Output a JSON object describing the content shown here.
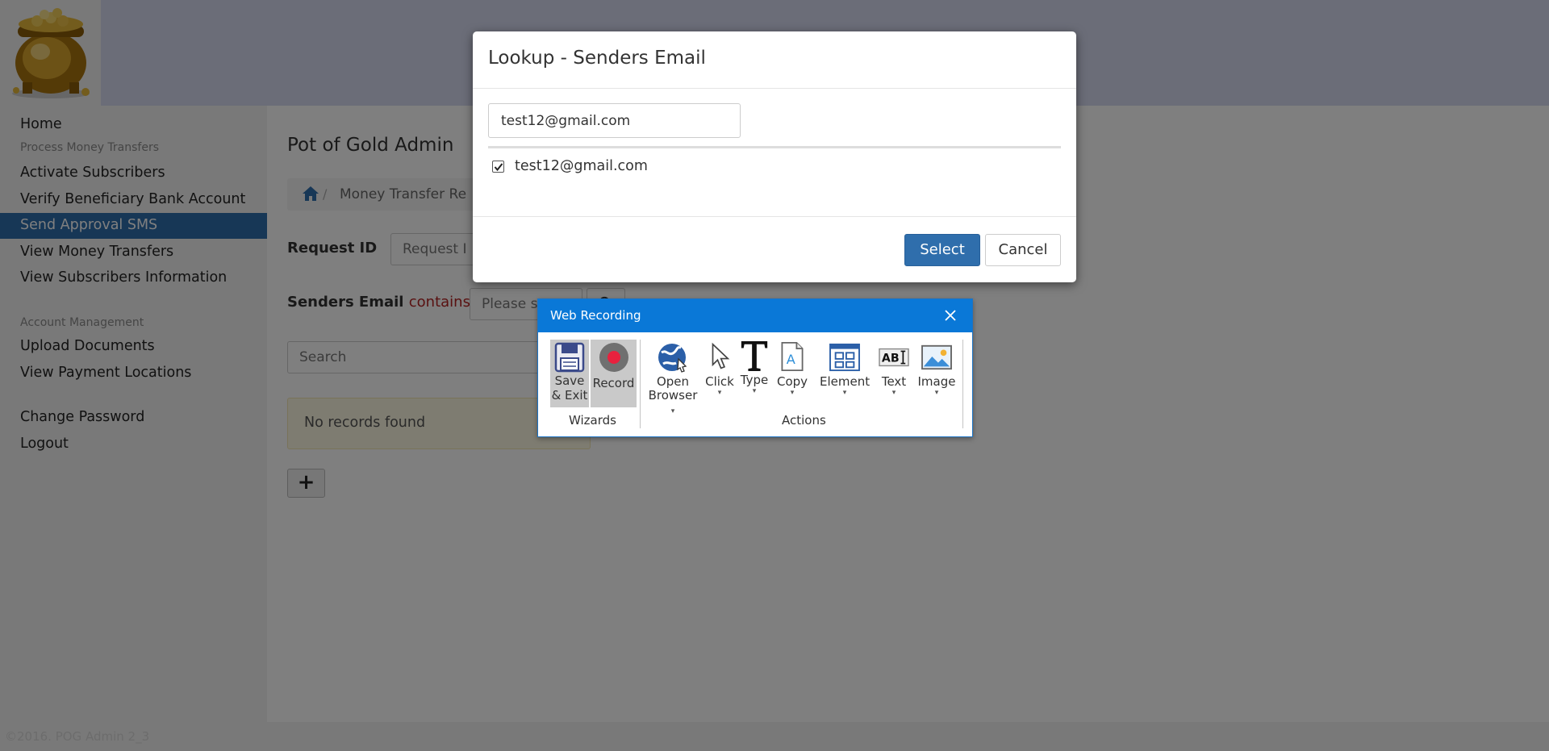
{
  "colors": {
    "accent": "#2f6eac",
    "recording_title_bar": "#0a78d7",
    "warning_bg": "#fcf8e3",
    "record_dot": "#e8213e"
  },
  "sidebar": {
    "items": [
      {
        "label": "Home"
      },
      {
        "label": "Process Money Transfers",
        "header": true
      },
      {
        "label": "Activate Subscribers"
      },
      {
        "label": "Verify Beneficiary Bank Account"
      },
      {
        "label": "Send Approval SMS",
        "active": true
      },
      {
        "label": "View Money Transfers"
      },
      {
        "label": "View Subscribers Information"
      },
      {
        "label": "Account Management",
        "header": true
      },
      {
        "label": "Upload Documents"
      },
      {
        "label": "View Payment Locations"
      },
      {
        "label": "Change Password"
      },
      {
        "label": "Logout"
      }
    ]
  },
  "main": {
    "title": "Pot of Gold Admin",
    "breadcrumb": {
      "separator": "/",
      "current": "Money Transfer Re"
    },
    "request_id": {
      "label": "Request ID",
      "placeholder": "Request I"
    },
    "senders_email": {
      "label": "Senders Email",
      "operator": "contains",
      "select_value": "Please s"
    },
    "search_placeholder": "Search",
    "no_records": "No records found",
    "add_button": "+"
  },
  "footer": {
    "text": "©2016. POG Admin 2_3"
  },
  "lookup_modal": {
    "title": "Lookup - Senders Email",
    "search_value": "test12@gmail.com",
    "results": [
      {
        "label": "test12@gmail.com",
        "checked": true
      }
    ],
    "select_label": "Select",
    "cancel_label": "Cancel"
  },
  "web_recording": {
    "title": "Web Recording",
    "wizards": {
      "label": "Wizards",
      "save_exit": "Save & Exit",
      "record": "Record"
    },
    "actions": {
      "label": "Actions",
      "open_browser_line1": "Open",
      "open_browser_line2": "Browser",
      "click": "Click",
      "type": "Type",
      "copy": "Copy",
      "element": "Element",
      "text": "Text",
      "image": "Image"
    },
    "icons": [
      "save-icon",
      "record-icon",
      "globe-icon",
      "cursor-icon",
      "type-icon",
      "copy-icon",
      "element-icon",
      "text-icon",
      "image-icon",
      "close-icon"
    ]
  }
}
